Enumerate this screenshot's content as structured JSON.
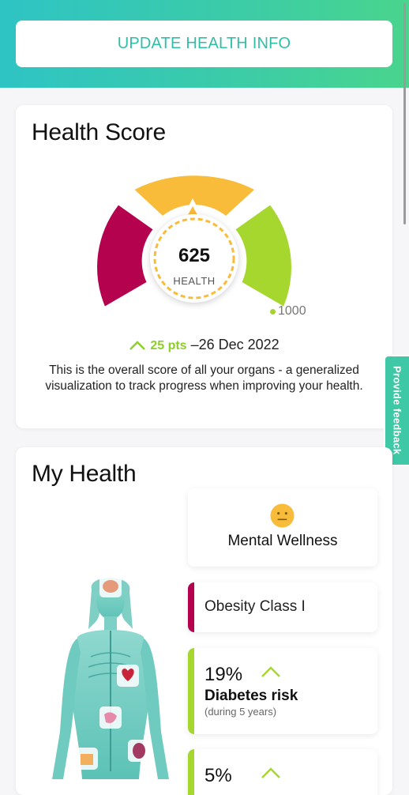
{
  "header": {
    "update_button_label": "UPDATE HEALTH INFO"
  },
  "health_score": {
    "title": "Health Score",
    "score": "625",
    "score_label": "HEALTH",
    "max_label": "1000",
    "change_points": "25 pts",
    "change_date": "–26 Dec 2022",
    "description": "This is the overall score of all your organs - a generalized visualization to track progress when improving your health.",
    "gauge_value_fraction": 0.625,
    "segment_colors": [
      "#b5024f",
      "#f8bb3a",
      "#a6d72f"
    ]
  },
  "feedback": {
    "label": "Provide feedback"
  },
  "my_health": {
    "title": "My Health",
    "mental": {
      "label": "Mental Wellness",
      "icon": "neutral-face-icon",
      "color": "#f8bb3a"
    },
    "obesity": {
      "label": "Obesity Class I",
      "color": "#b5024f"
    },
    "diabetes": {
      "percent": "19%",
      "label": "Diabetes risk",
      "sub": "(during 5 years)",
      "trend": "up",
      "color": "#a6d72f"
    },
    "third_stat": {
      "percent": "5%",
      "trend": "up",
      "color": "#a6d72f"
    },
    "organ_icons": [
      "brain-icon",
      "heart-icon",
      "stomach-icon",
      "kidney-icon",
      "fat-tissue-icon"
    ]
  },
  "colors": {
    "accent": "#3ec8a6",
    "up_trend": "#8fce2a"
  }
}
